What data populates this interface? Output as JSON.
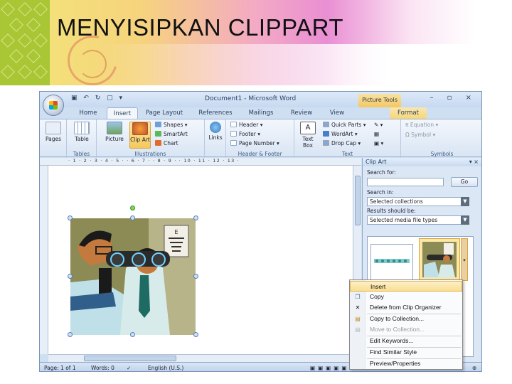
{
  "slide": {
    "title": "MENYISIPKAN CLIPPART"
  },
  "window": {
    "title": "Document1 - Microsoft Word",
    "picture_tools": "Picture Tools",
    "controls": "–  ▫  ×"
  },
  "tabs": [
    "Home",
    "Insert",
    "Page Layout",
    "References",
    "Mailings",
    "Review",
    "View",
    "Format"
  ],
  "active_tab": "Insert",
  "ribbon": {
    "pages": {
      "label": "Pages",
      "group": ""
    },
    "tables": {
      "label": "Table",
      "group": "Tables"
    },
    "picture": {
      "label": "Picture"
    },
    "clip_art": {
      "label": "Clip Art"
    },
    "shapes": "Shapes",
    "smartart": "SmartArt",
    "chart": "Chart",
    "illustrations_group": "Illustrations",
    "links": {
      "label": "Links",
      "group": ""
    },
    "header": "Header",
    "footer": "Footer",
    "page_number": "Page Number",
    "header_footer_group": "Header & Footer",
    "text_box": "Text Box",
    "quick_parts": "Quick Parts",
    "wordart": "WordArt",
    "drop_cap": "Drop Cap",
    "text_group": "Text",
    "equation": "Equation",
    "symbol": "Symbol",
    "symbols_group": "Symbols"
  },
  "ruler": {
    "numbers": "· 1 · 2 · 3 · 4 · 5 · · 6 · 7 · · 8 · 9 · · 10 · 11 · 12 · 13 ·"
  },
  "clip_pane": {
    "title": "Clip Art",
    "search_for_label": "Search for:",
    "search_value": "",
    "go_label": "Go",
    "search_in_label": "Search in:",
    "search_in_value": "Selected collections",
    "results_label": "Results should be:",
    "results_value": "Selected media file types"
  },
  "context_menu": {
    "items": [
      {
        "label": "Insert",
        "icon": "insert-icon",
        "enabled": true,
        "highlight": true
      },
      {
        "label": "Copy",
        "icon": "copy-icon",
        "enabled": true
      },
      {
        "label": "Delete from Clip Organizer",
        "icon": "delete-icon",
        "enabled": true
      },
      {
        "label": "Copy to Collection...",
        "icon": "collection-icon",
        "enabled": true
      },
      {
        "label": "Move to Collection...",
        "icon": "move-icon",
        "enabled": false
      },
      {
        "label": "Edit Keywords...",
        "icon": "",
        "enabled": true
      },
      {
        "label": "Find Similar Style",
        "icon": "",
        "enabled": true
      },
      {
        "label": "Preview/Properties",
        "icon": "",
        "enabled": true
      }
    ]
  },
  "statusbar": {
    "page": "Page: 1 of 1",
    "words": "Words: 0",
    "language": "English (U.S.)"
  }
}
